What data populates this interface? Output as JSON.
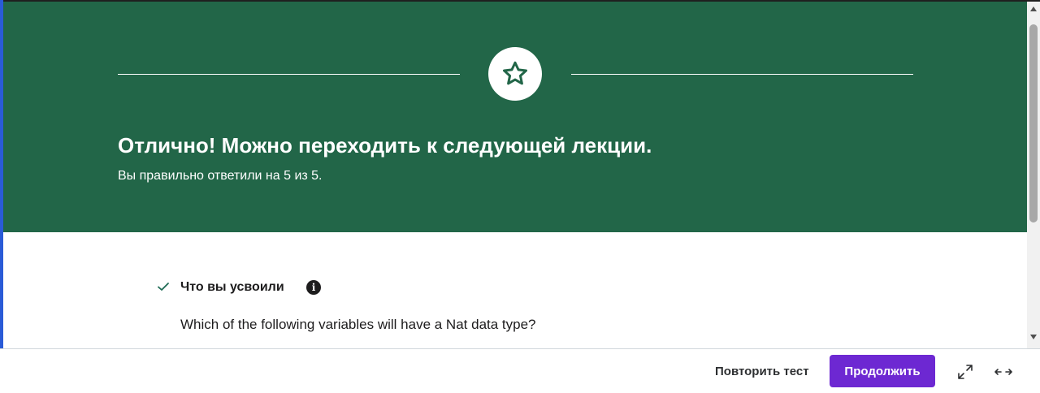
{
  "banner": {
    "title": "Отлично! Можно переходить к следующей лекции.",
    "subtitle": "Вы правильно ответили на 5 из 5.",
    "icon": "star-icon",
    "background_color": "#226648"
  },
  "content": {
    "section_title": "Что вы усвоили",
    "question": "Which of the following variables will have a Nat data type?",
    "check_icon": "check-icon",
    "info_icon_text": "i"
  },
  "footer": {
    "retry_label": "Повторить тест",
    "continue_label": "Продолжить",
    "accent_color": "#6d28d2",
    "expand_icon": "expand-icon",
    "arrows_icon": "horizontal-arrows-icon"
  }
}
